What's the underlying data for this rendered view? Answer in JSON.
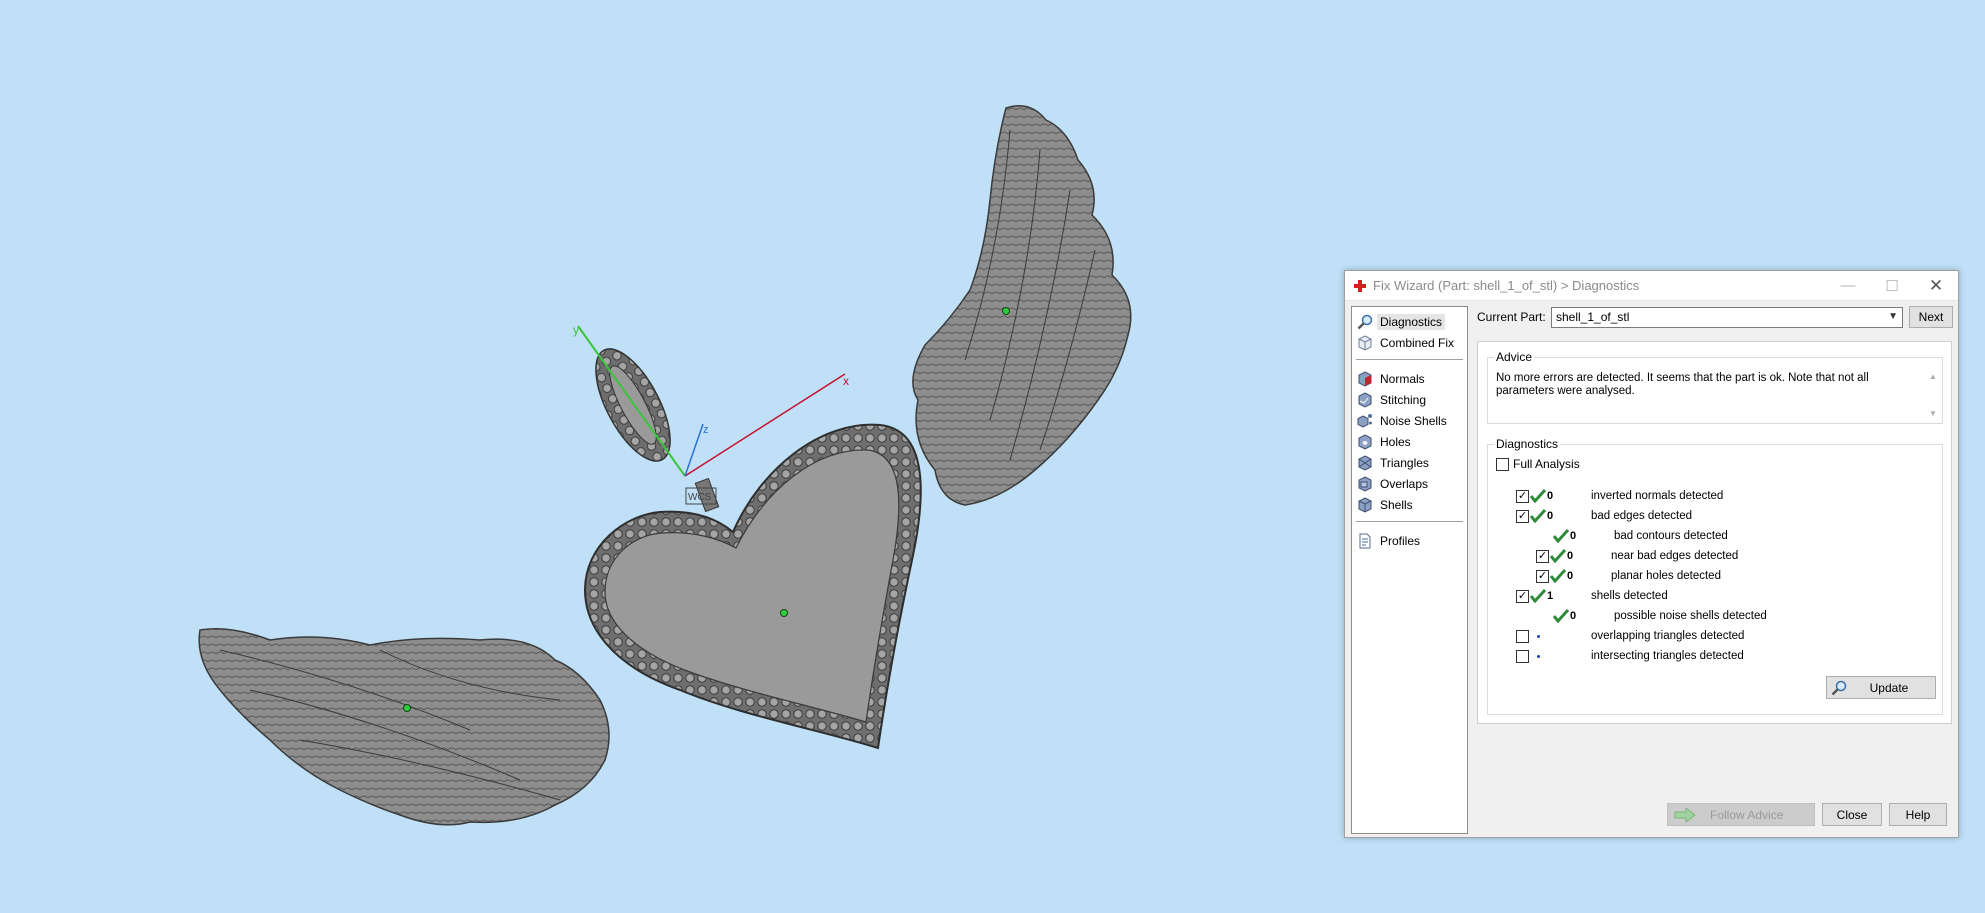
{
  "viewport": {
    "axis_labels": {
      "x": "x",
      "y": "y",
      "z": "z"
    },
    "wcs_label": "WCS"
  },
  "dialog": {
    "title": "Fix Wizard (Part: shell_1_of_stl) > Diagnostics",
    "window_controls": {
      "minimize": "—",
      "maximize": "☐",
      "close": "✕"
    },
    "nav": {
      "top_items": [
        {
          "label": "Diagnostics",
          "icon": "magnifier-icon",
          "selected": true
        },
        {
          "label": "Combined Fix",
          "icon": "cube-icon"
        }
      ],
      "fix_items": [
        {
          "label": "Normals",
          "icon": "normals-cube-icon"
        },
        {
          "label": "Stitching",
          "icon": "stitching-cube-icon"
        },
        {
          "label": "Noise Shells",
          "icon": "noise-shells-icon"
        },
        {
          "label": "Holes",
          "icon": "holes-cube-icon"
        },
        {
          "label": "Triangles",
          "icon": "triangles-cube-icon"
        },
        {
          "label": "Overlaps",
          "icon": "overlaps-cube-icon"
        },
        {
          "label": "Shells",
          "icon": "shells-cube-icon"
        }
      ],
      "bottom_items": [
        {
          "label": "Profiles",
          "icon": "profiles-document-icon"
        }
      ]
    },
    "current_part_label": "Current Part:",
    "current_part_value": "shell_1_of_stl",
    "next_label": "Next",
    "advice": {
      "title": "Advice",
      "text": "No more errors are detected. It seems that the part is ok. Note that not all parameters were analysed."
    },
    "diagnostics": {
      "title": "Diagnostics",
      "full_analysis_label": "Full Analysis",
      "rows": [
        {
          "count": "0",
          "label": "inverted normals detected"
        },
        {
          "count": "0",
          "label": "bad edges detected"
        },
        {
          "count": "0",
          "label": "bad contours detected"
        },
        {
          "count": "0",
          "label": "near bad edges detected"
        },
        {
          "count": "0",
          "label": "planar holes detected"
        },
        {
          "count": "1",
          "label": "shells detected"
        },
        {
          "count": "0",
          "label": "possible noise shells detected"
        },
        {
          "count": "",
          "label": "overlapping triangles detected"
        },
        {
          "count": "",
          "label": "intersecting triangles detected"
        }
      ],
      "update_label": "Update"
    },
    "buttons": {
      "follow_advice": "Follow Advice",
      "close": "Close",
      "help": "Help"
    }
  },
  "colors": {
    "background": "#bfe0f7",
    "model_gray": "#8f8f8f",
    "check_green": "#2e8b3a",
    "axis_x": "#c8102e",
    "axis_y": "#3cc43c",
    "axis_z": "#2f6fd0"
  }
}
